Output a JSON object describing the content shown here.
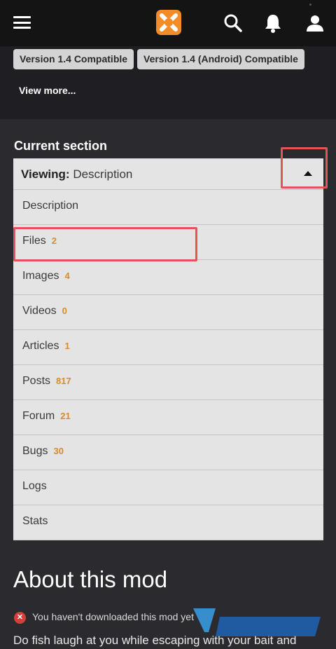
{
  "header": {
    "menu_icon": "hamburger-icon",
    "logo_icon": "nexus-logo-icon",
    "search_icon": "search-icon",
    "notifications_icon": "bell-icon",
    "account_icon": "user-icon"
  },
  "tags": [
    {
      "label": "Version 1.4 Compatible"
    },
    {
      "label": "Version 1.4 (Android) Compatible"
    }
  ],
  "view_more_label": "View more...",
  "current_section": {
    "title": "Current section",
    "viewing_prefix": "Viewing:",
    "viewing_value": "Description",
    "items": [
      {
        "label": "Description",
        "count": ""
      },
      {
        "label": "Files",
        "count": "2"
      },
      {
        "label": "Images",
        "count": "4"
      },
      {
        "label": "Videos",
        "count": "0"
      },
      {
        "label": "Articles",
        "count": "1"
      },
      {
        "label": "Posts",
        "count": "817"
      },
      {
        "label": "Forum",
        "count": "21"
      },
      {
        "label": "Bugs",
        "count": "30"
      },
      {
        "label": "Logs",
        "count": ""
      },
      {
        "label": "Stats",
        "count": ""
      }
    ]
  },
  "about": {
    "title": "About this mod",
    "warning": "You haven't downloaded this mod yet",
    "description": "Do fish laugh at you while escaping with your bait and"
  },
  "colors": {
    "header_bg": "#141414",
    "page_bg": "#2b2b2f",
    "accent_count": "#d98b2b",
    "highlight_box": "#e8505b"
  }
}
